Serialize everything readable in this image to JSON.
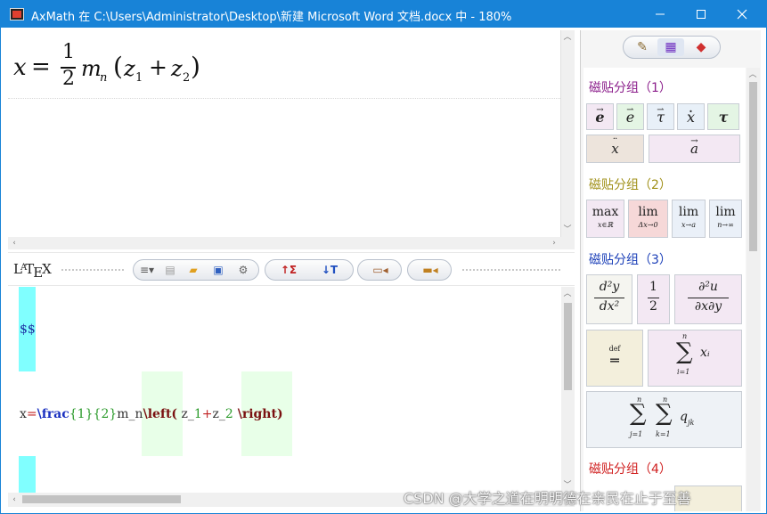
{
  "window": {
    "title": "AxMath 在 C:\\Users\\Administrator\\Desktop\\新建 Microsoft Word 文档.docx 中 - 180%",
    "minimize_icon": "minimize-icon",
    "maximize_icon": "maximize-icon",
    "close_icon": "close-icon"
  },
  "editor": {
    "formula": {
      "lhs": "x",
      "eq": "=",
      "numerator": "1",
      "denominator": "2",
      "m": "m",
      "m_sub": "n",
      "lparen": "(",
      "z1": "z",
      "z1_sub": "1",
      "plus": "+",
      "z2": "z",
      "z2_sub": "2",
      "rparen": ")"
    }
  },
  "toolbar": {
    "latex_logo": {
      "l": "L",
      "a": "A",
      "t": "T",
      "e": "E",
      "x": "X"
    },
    "buttons": [
      {
        "icon": "list-dropdown-icon",
        "glyph": "≡▾"
      },
      {
        "icon": "new-document-icon",
        "glyph": "▤"
      },
      {
        "icon": "open-folder-icon",
        "glyph": "▰"
      },
      {
        "icon": "save-icon",
        "glyph": "▣"
      },
      {
        "icon": "settings-gear-icon",
        "glyph": "⚙"
      },
      {
        "icon": "export-latex-up-icon",
        "glyph": "↑Σ"
      },
      {
        "icon": "import-latex-down-icon",
        "glyph": "↓T"
      },
      {
        "icon": "insert-to-word-icon",
        "glyph": "▭◂"
      },
      {
        "icon": "toolbox-icon",
        "glyph": "▬◂"
      }
    ]
  },
  "code": {
    "line1": "$$",
    "line2": {
      "x": "x",
      "eq": "=",
      "frac": "\\frac",
      "lb1": "{",
      "n1": "1",
      "rb1": "}",
      "lb2": "{",
      "n2": "2",
      "rb2": "}",
      "mn": "m_n",
      "left": "\\left(",
      "z1a": " z_",
      "one": "1",
      "plus": "+",
      "z2a": "z_",
      "two": "2",
      "right": " \\right)"
    }
  },
  "right_panel": {
    "tabs": [
      {
        "icon": "brush-icon",
        "glyph": "✎"
      },
      {
        "icon": "color-grid-icon",
        "glyph": "▦"
      },
      {
        "icon": "eraser-icon",
        "glyph": "◆"
      }
    ],
    "groups": [
      {
        "title": "磁贴分组（1）",
        "color": "#8b1e8b"
      },
      {
        "title": "磁贴分组（2）",
        "color": "#a09018"
      },
      {
        "title": "磁贴分组（3）",
        "color": "#1b3fb8"
      },
      {
        "title": "磁贴分组（4）",
        "color": "#d02020"
      }
    ],
    "tiles": {
      "g1": [
        {
          "text": "e",
          "top": "→"
        },
        {
          "text": "e",
          "top": "⇀"
        },
        {
          "text": "τ",
          "top": "⇀"
        },
        {
          "text": "x",
          "top": "·"
        },
        {
          "text": "τ",
          "top": ""
        },
        {
          "text": "x",
          "top": "¨"
        },
        {
          "text": "a",
          "top": "→"
        }
      ],
      "g2": [
        {
          "main": "max",
          "sub": "x∈ℝ"
        },
        {
          "main": "lim",
          "sub": "Δx→0"
        },
        {
          "main": "lim",
          "sub": "x→a"
        },
        {
          "main": "lim",
          "sub": "n→∞"
        }
      ],
      "g3": {
        "deriv": {
          "num": "d²y",
          "den": "dx²"
        },
        "half": {
          "num": "1",
          "den": "2"
        },
        "partial": {
          "num": "∂²u",
          "den": "∂x∂y"
        },
        "def": {
          "top": "def",
          "sym": "═"
        },
        "sum": {
          "sup": "n",
          "sym": "∑",
          "sub": "i=1",
          "body": "xᵢ"
        },
        "dsum": {
          "sup1": "n",
          "sup2": "n",
          "sym": "∑",
          "sub1": "j=1",
          "sub2": "k=1",
          "body": "q",
          "body_sub": "jk"
        }
      }
    }
  },
  "watermark": "CSDN @大学之道在明明德在亲民在止于至善"
}
